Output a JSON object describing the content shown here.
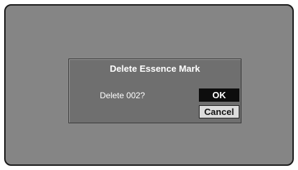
{
  "dialog": {
    "title": "Delete Essence Mark",
    "message": "Delete 002?",
    "ok_label": "OK",
    "cancel_label": "Cancel"
  },
  "colors": {
    "screen_bg": "#858585",
    "dialog_bg": "#6f6f6f",
    "selected_button_bg": "#0d0d0d",
    "button_bg": "#dcdcdc"
  }
}
